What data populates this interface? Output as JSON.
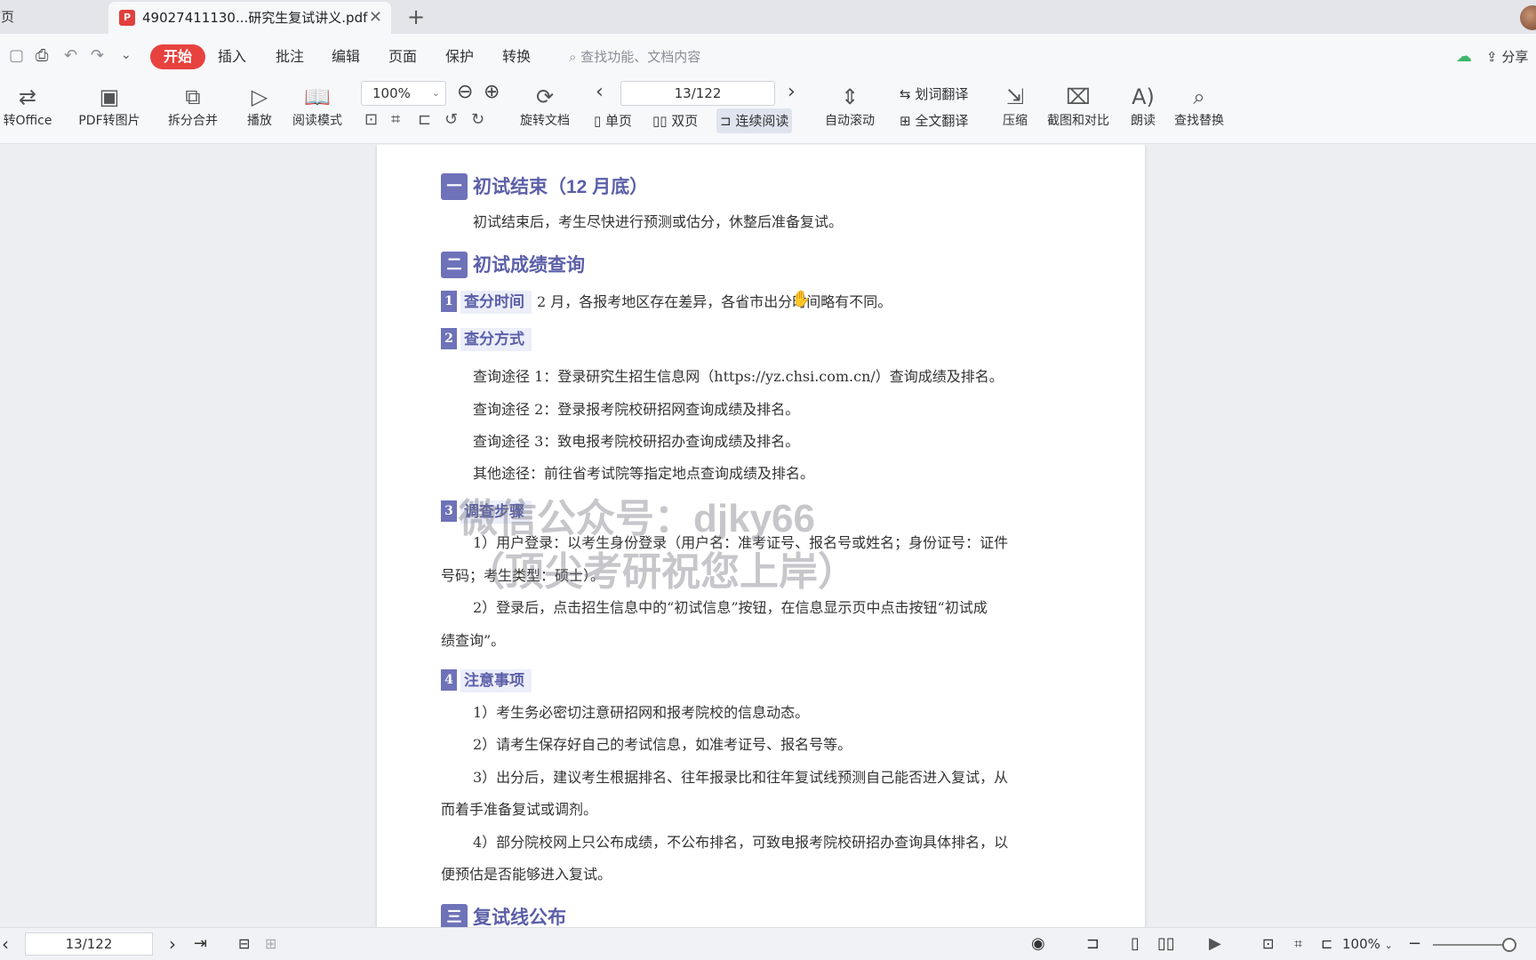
{
  "tabs": {
    "home": "首页",
    "document": "49027411130...研究生复试讲义.pdf",
    "add": "+"
  },
  "menu": {
    "items": [
      "开始",
      "插入",
      "批注",
      "编辑",
      "页面",
      "保护",
      "转换"
    ],
    "active": "开始",
    "search_placeholder": "查找功能、文档内容",
    "share": "分享"
  },
  "ribbon": {
    "to_office": "转Office",
    "pdf_to_image": "PDF转图片",
    "split_merge": "拆分合并",
    "play": "播放",
    "reading_mode": "阅读模式",
    "zoom": "100%",
    "rotate_doc": "旋转文档",
    "page_indicator": "13/122",
    "single_page": "单页",
    "double_page": "双页",
    "continuous": "连续阅读",
    "auto_scroll": "自动滚动",
    "word_translate": "划词翻译",
    "full_translate": "全文翻译",
    "compress": "压缩",
    "screenshot_compare": "截图和对比",
    "read_aloud": "朗读",
    "find_replace": "查找替换"
  },
  "document": {
    "sections": [
      {
        "num": "一",
        "title": "初试结束（12 月底）"
      },
      {
        "num": "二",
        "title": "初试成绩查询"
      },
      {
        "num": "三",
        "title": "复试线公布"
      }
    ],
    "section1_text": "初试结束后，考生尽快进行预测或估分，休整后准备复试。",
    "sub1": {
      "num": "1",
      "title": "查分时间",
      "text": "2 月，各报考地区存在差异，各省市出分时间略有不同。"
    },
    "sub2": {
      "num": "2",
      "title": "查分方式"
    },
    "methods": [
      "查询途径 1：登录研究生招生信息网（https://yz.chsi.com.cn/）查询成绩及排名。",
      "查询途径 2：登录报考院校研招网查询成绩及排名。",
      "查询途径 3：致电报考院校研招办查询成绩及排名。",
      "其他途径：前往省考试院等指定地点查询成绩及排名。"
    ],
    "sub3": {
      "num": "3",
      "title": "调查步骤"
    },
    "steps": [
      "1）用户登录：以考生身份登录（用户名：准考证号、报名号或姓名；身份证号：证件",
      "号码；考生类型：硕士）。",
      "2）登录后，点击招生信息中的“初试信息”按钮，在信息显示页中点击按钮“初试成",
      "绩查询”。"
    ],
    "sub4": {
      "num": "4",
      "title": "注意事项"
    },
    "notes": [
      "1）考生务必密切注意研招网和报考院校的信息动态。",
      "2）请考生保存好自己的考试信息，如准考证号、报名号等。",
      "3）出分后，建议考生根据排名、往年报录比和往年复试线预测自己能否进入复试，从",
      "而着手准备复试或调剂。",
      "4）部分院校网上只公布成绩，不公布排名，可致电报考院校研招办查询具体排名，以",
      "便预估是否能够进入复试。"
    ],
    "watermark_line1": "微信公众号：djky66",
    "watermark_line2": "（顶尖考研祝您上岸）"
  },
  "status": {
    "page": "13/122",
    "zoom": "100%"
  }
}
